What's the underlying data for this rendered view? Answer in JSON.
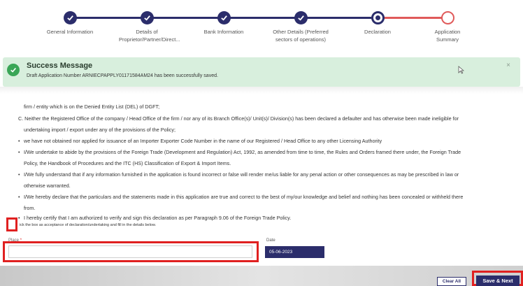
{
  "stepper": {
    "steps": [
      {
        "label": "General Information",
        "state": "done"
      },
      {
        "label": "Details of Proprietor/Partner/Direct...",
        "state": "done"
      },
      {
        "label": "Bank Information",
        "state": "done"
      },
      {
        "label": "Other Details (Preferred sectors of operations)",
        "state": "done"
      },
      {
        "label": "Declaration",
        "state": "current"
      },
      {
        "label": "Application Summary",
        "state": "pending"
      }
    ]
  },
  "success": {
    "title": "Success Message",
    "message": "Draft Application Number ARNIECPAPPLY01171584AM24 has been successfully saved.",
    "close": "×"
  },
  "declaration": {
    "lines": [
      "firm / entity which is on the Denied Entity List (DEL) of DGFT;",
      "C. Neither the Registered Office of the company / Head Office of the firm / nor any of its Branch Office(s)/ Unit(s)/ Division(s) has been declared a defaulter and has otherwise been made ineligible for",
      "undertaking import / export under any of the provisions of the Policy;",
      "we have not obtained nor applied for issuance of an Importer Exporter Code Number in the name of our Registered / Head Office to any other Licensing Authority",
      "I/We undertake to abide by the provisions of the Foreign Trade (Development and Regulation) Act, 1992, as amended from time to time, the Rules and Orders framed there under, the Foreign Trade",
      "Policy, the Handbook of Procedures and the ITC (HS) Classification of Export & Import Items.",
      "I/We fully understand that if any information furnished in the application is found incorrect or false will render me/us liable for any penal action or other consequences as may be prescribed in law or",
      "otherwise warranted.",
      "I/We hereby declare that the particulars and the statements made in this application are true and correct to the best of my/our knowledge and belief and nothing has been concealed or withheld there",
      "from.",
      "I hereby certify that I am authorized to verify and sign this declaration as per Paragraph 9.06 of the Foreign Trade Policy."
    ],
    "checkbox_label": "ick the box as acceptance of declaration/undertaking and fill in the details below."
  },
  "form": {
    "place_label": "Place",
    "place_required": "*",
    "place_value": "",
    "date_label": "Date",
    "date_value": "05-06-2023"
  },
  "footer": {
    "clear_label": "Clear All",
    "save_label": "Save & Next"
  },
  "colors": {
    "primary": "#2b2d6b",
    "success_bg": "#d8efdd",
    "success_icon": "#3aa657",
    "highlight": "#e02020"
  }
}
